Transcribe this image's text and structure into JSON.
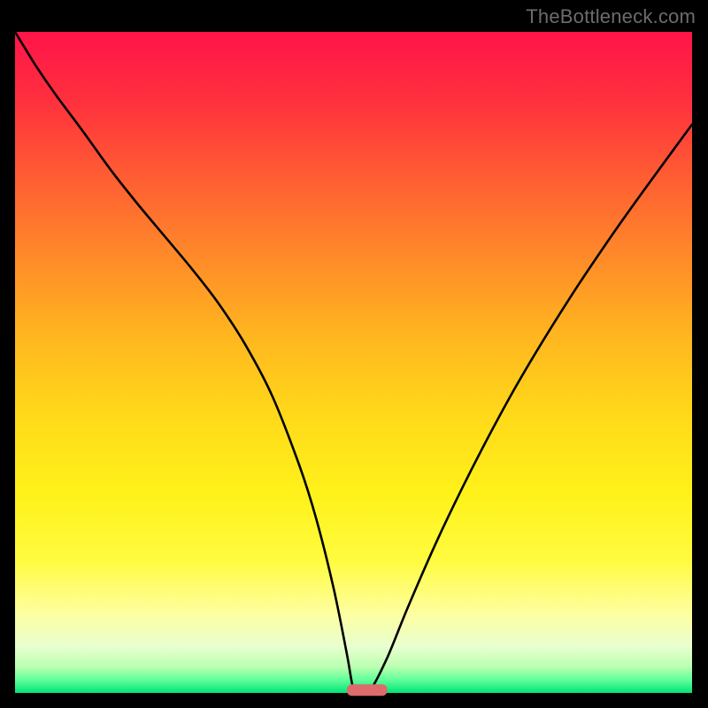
{
  "watermark": {
    "text": "TheBottleneck.com"
  },
  "chart_data": {
    "type": "line",
    "title": "",
    "xlabel": "",
    "ylabel": "",
    "xlim": [
      0,
      100
    ],
    "ylim": [
      0,
      100
    ],
    "grid": false,
    "legend": false,
    "series": [
      {
        "name": "curve",
        "x": [
          0,
          3,
          6,
          10,
          14,
          18,
          22,
          26,
          30,
          34,
          38,
          42,
          44.5,
          47,
          49,
          50,
          51,
          52.5,
          55,
          58,
          62,
          66,
          70,
          74,
          78,
          83,
          88,
          93,
          100
        ],
        "y": [
          100,
          95,
          90.5,
          85,
          79.3,
          74.1,
          69.2,
          64.3,
          59,
          52.7,
          44.9,
          34.4,
          26.3,
          16.1,
          6.0,
          0.5,
          0.5,
          0.5,
          5.4,
          12.9,
          22.3,
          30.9,
          38.9,
          46.4,
          53.3,
          61.4,
          69.0,
          76.2,
          86.0
        ]
      }
    ],
    "marker": {
      "name": "bottom-marker",
      "x_range": [
        49,
        55
      ],
      "y": 0.5,
      "color": "#dd6b6b"
    },
    "background_gradient": {
      "stops": [
        {
          "pos": 0.0,
          "color": "#ff1449"
        },
        {
          "pos": 0.22,
          "color": "#ff5d33"
        },
        {
          "pos": 0.46,
          "color": "#ffb61f"
        },
        {
          "pos": 0.7,
          "color": "#fff21a"
        },
        {
          "pos": 0.88,
          "color": "#fdffa0"
        },
        {
          "pos": 0.96,
          "color": "#bcffb1"
        },
        {
          "pos": 1.0,
          "color": "#00e378"
        }
      ]
    }
  }
}
